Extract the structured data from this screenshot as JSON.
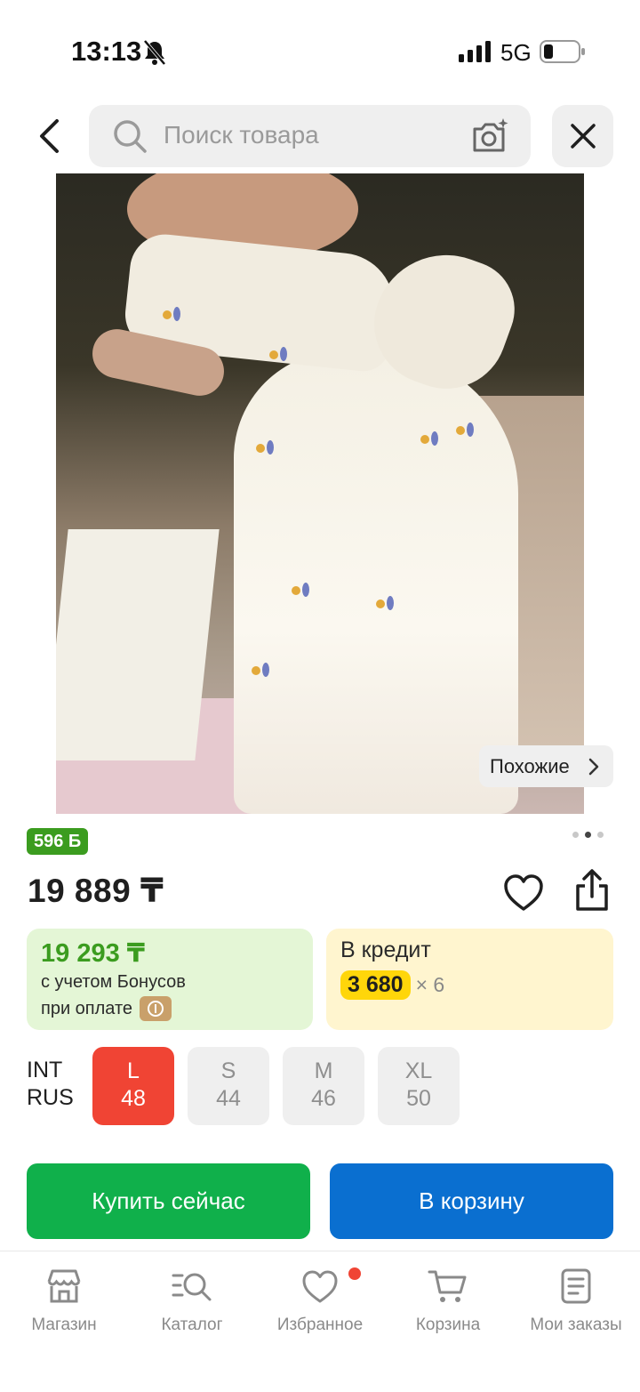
{
  "status_bar": {
    "time": "13:13",
    "network": "5G"
  },
  "search": {
    "placeholder": "Поиск товара"
  },
  "product": {
    "similar_label": "Похожие",
    "bonus_points": "596 Б",
    "price": "19 889 ₸",
    "gallery_dots": 3,
    "gallery_active_index": 1
  },
  "bonus_card": {
    "amount": "19 293 ₸",
    "line1": "с учетом Бонусов",
    "line2": "при оплате"
  },
  "credit_card": {
    "title": "В кредит",
    "monthly": "3 680",
    "multiplier": "× 6"
  },
  "sizes": {
    "legend_int": "INT",
    "legend_rus": "RUS",
    "options": [
      {
        "int": "L",
        "rus": "48",
        "selected": true
      },
      {
        "int": "S",
        "rus": "44",
        "selected": false
      },
      {
        "int": "M",
        "rus": "46",
        "selected": false
      },
      {
        "int": "XL",
        "rus": "50",
        "selected": false
      }
    ]
  },
  "actions": {
    "buy_now": "Купить сейчас",
    "add_to_cart": "В корзину"
  },
  "bottom_nav": {
    "items": [
      {
        "label": "Магазин",
        "icon": "store-icon"
      },
      {
        "label": "Каталог",
        "icon": "catalog-search-icon"
      },
      {
        "label": "Избранное",
        "icon": "heart-icon"
      },
      {
        "label": "Корзина",
        "icon": "cart-icon"
      },
      {
        "label": "Мои заказы",
        "icon": "orders-icon"
      }
    ]
  },
  "colors": {
    "green_buy": "#10b04b",
    "blue_cart": "#0a6fd0",
    "selected_size": "#f04434",
    "bonus_green": "#3b9c1f",
    "credit_yellow": "#ffd60a"
  }
}
